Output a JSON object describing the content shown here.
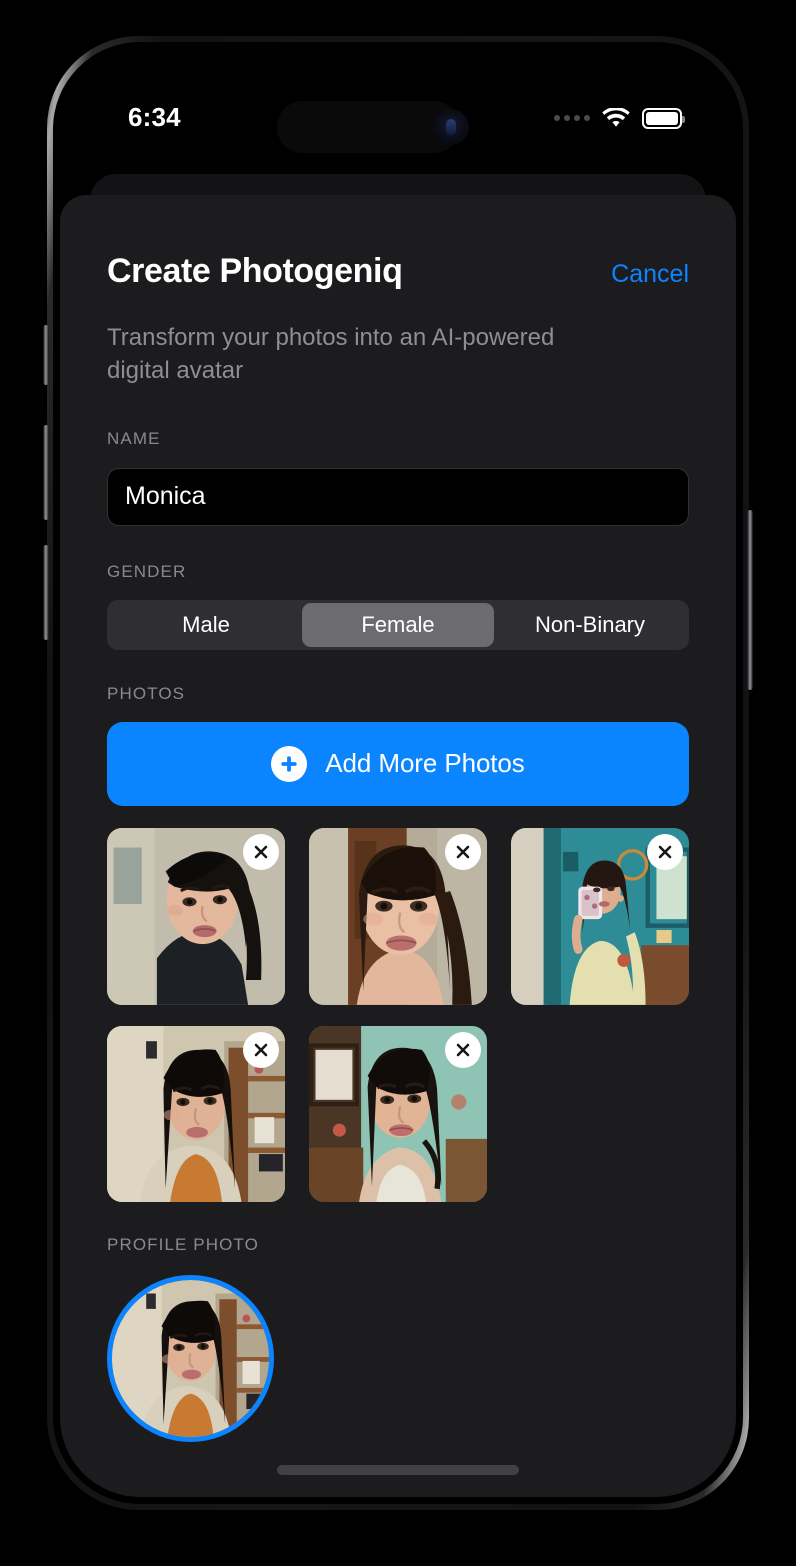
{
  "status_bar": {
    "time": "6:34",
    "cellular_icon": "cellular-dots-icon",
    "wifi_icon": "wifi-icon",
    "battery_icon": "battery-icon"
  },
  "sheet": {
    "title": "Create Photogeniq",
    "cancel_label": "Cancel",
    "subtitle": "Transform your photos into an AI-powered digital avatar",
    "name": {
      "label": "NAME",
      "value": "Monica",
      "placeholder": "Enter name"
    },
    "gender": {
      "label": "GENDER",
      "options": [
        {
          "label": "Male",
          "selected": false
        },
        {
          "label": "Female",
          "selected": true
        },
        {
          "label": "Non-Binary",
          "selected": false
        }
      ],
      "selected": "Female"
    },
    "photos": {
      "label": "PHOTOS",
      "add_button_label": "Add More Photos",
      "add_button_icon": "plus-circle-icon",
      "remove_icon": "close-x-icon",
      "count": 5,
      "items": [
        {
          "alt": "Woman with black bangs looking left, beige wall"
        },
        {
          "alt": "Woman facing camera, wooden door background"
        },
        {
          "alt": "Woman taking mirror selfie with phone, teal room"
        },
        {
          "alt": "Woman in orange and cream top, bookshelf background"
        },
        {
          "alt": "Woman in white tank top, green room background"
        }
      ]
    },
    "profile_photo": {
      "label": "PROFILE PHOTO",
      "alt": "Woman in orange and cream top, bookshelf background",
      "border_color": "#0a84ff"
    }
  },
  "colors": {
    "accent": "#0a84ff",
    "sheet_background": "#1c1c1e",
    "input_background": "#000000",
    "segment_track": "#2f2f33",
    "segment_selected": "#6c6c70",
    "label_text": "#8a8a8e",
    "subtitle_text": "#8e8e93"
  }
}
